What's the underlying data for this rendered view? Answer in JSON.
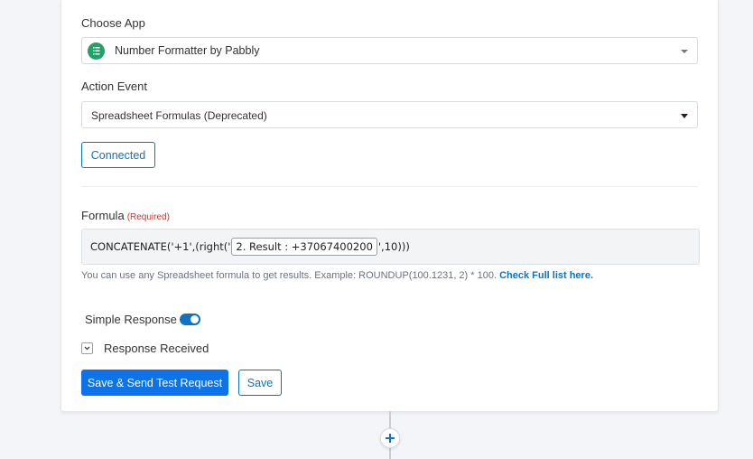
{
  "choose_app": {
    "label": "Choose App",
    "selected": "Number Formatter by Pabbly",
    "icon": "number-formatter-app-icon",
    "icon_color": "#21a366"
  },
  "action_event": {
    "label": "Action Event",
    "selected": "Spreadsheet Formulas (Deprecated)"
  },
  "connected_button": "Connected",
  "formula": {
    "label": "Formula",
    "required_text": "(Required)",
    "prefix": "CONCATENATE('+1',(right('",
    "token": "2. Result : +37067400200",
    "suffix": "',10)))",
    "help_text": "You can use any Spreadsheet formula to get results. Example: ROUNDUP(100.1231, 2) * 100.",
    "help_link": "Check Full list here."
  },
  "simple_response": {
    "label": "Simple Response",
    "enabled": true
  },
  "response_received": {
    "label": "Response Received"
  },
  "buttons": {
    "save_send": "Save & Send Test Request",
    "save": "Save"
  },
  "colors": {
    "primary": "#0e72e9",
    "accent": "#0e72c7",
    "required": "#d0342c"
  }
}
